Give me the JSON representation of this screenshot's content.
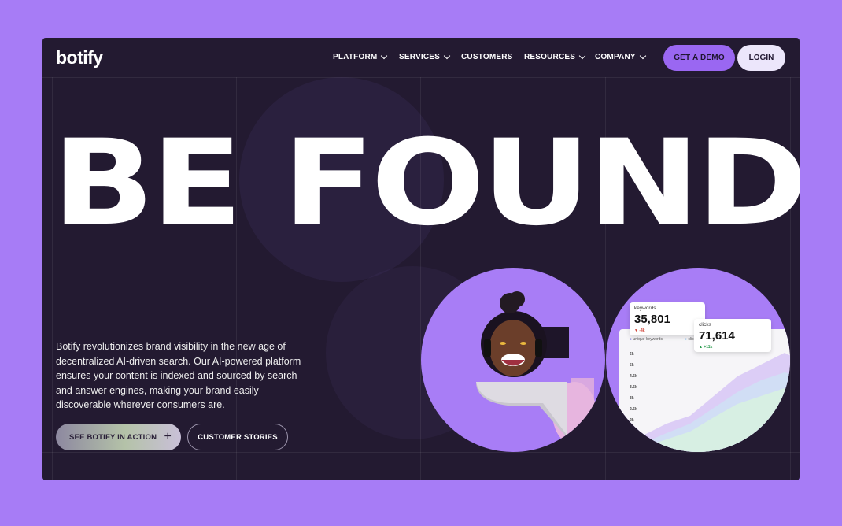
{
  "brand": {
    "logo": "botify"
  },
  "nav": {
    "items": [
      {
        "label": "PLATFORM",
        "dropdown": true
      },
      {
        "label": "SERVICES",
        "dropdown": true
      },
      {
        "label": "CUSTOMERS",
        "dropdown": false
      },
      {
        "label": "RESOURCES",
        "dropdown": true
      },
      {
        "label": "COMPANY",
        "dropdown": true
      }
    ],
    "demo_label": "GET A DEMO",
    "login_label": "LOGIN"
  },
  "hero": {
    "headline": "BE FOUND",
    "description": "Botify revolutionizes brand visibility in the new age of decentralized AI-driven search. Our AI-powered platform ensures your content is indexed and sourced by search and answer engines, making your brand easily discoverable wherever consumers are.",
    "primary_cta": "SEE BOTIFY IN ACTION",
    "secondary_cta": "CUSTOMER STORIES"
  },
  "dashboard": {
    "keywords_card": {
      "label": "keywords",
      "value": "35,801",
      "change": "▼ -4k"
    },
    "clicks_card": {
      "label": "clicks",
      "value": "71,614",
      "change": "▲ +11k"
    },
    "legend": [
      "unique keywords",
      "clic"
    ],
    "y_ticks": [
      "6k",
      "5k",
      "4.5k",
      "3.5k",
      "3k",
      "2.5k",
      "2k"
    ]
  },
  "colors": {
    "page_bg": "#a77cf6",
    "frame_bg": "#231a31",
    "accent": "#9a67f2",
    "circle": "#a87df6"
  }
}
